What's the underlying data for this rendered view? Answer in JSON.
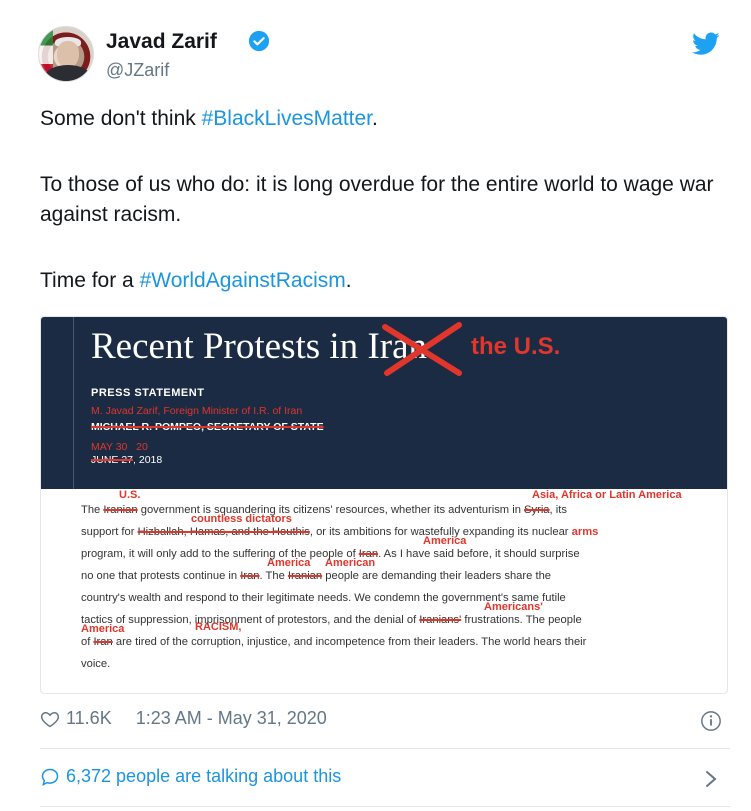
{
  "author": {
    "name": "Javad Zarif",
    "handle": "@JZarif"
  },
  "tweet": {
    "line1_text": "Some don't think ",
    "line1_hashtag": "#BlackLivesMatter",
    "line1_end": ".",
    "line2": "To those of us who do: it is long overdue for the entire world to wage war against racism.",
    "line3_text": "Time for a ",
    "line3_hashtag": "#WorldAgainstRacism",
    "line3_end": "."
  },
  "media": {
    "title": "Recent Protests in ",
    "title_struck": "Iran",
    "title_replacement": "the U.S.",
    "press_statement": "PRESS STATEMENT",
    "author_new": "M. Javad Zarif, Foreign Minister of I.R. of Iran",
    "author_old": "MICHAEL R. POMPEO, SECRETARY OF STATE",
    "date_new_month": "MAY 30",
    "date_new_year": "20",
    "date_old": "JUNE 27",
    "date_old_year": ", 2018",
    "annotations": {
      "us": "U.S.",
      "asia": "Asia, Africa or Latin America",
      "dictators": "countless dictators",
      "arms": "arms",
      "america1": "America",
      "america2": "America",
      "american": "American",
      "americans": "Americans'",
      "america3": "America",
      "racism": "RACISM,"
    },
    "body": {
      "p1a": "The ",
      "p1_struck": "Iranian",
      "p1b": " government is squandering its citizens' resources, whether its adventurism in ",
      "p1_struck2": "Syria",
      "p1c": ", its",
      "p2a": "support for ",
      "p2_struck": "Hizballah, Hamas, and the Houthis",
      "p2b": ", or its ambitions for wastefully expanding its nuclear ",
      "p3a": "program, it will only add to the suffering of the people of ",
      "p3_struck": "Iran",
      "p3b": ". As I have said before, it should surprise",
      "p4a": "no one that protests continue in ",
      "p4_struck": "Iran",
      "p4b": ". The ",
      "p4_struck2": "Iranian",
      "p4c": " people are demanding their leaders share the",
      "p5": "country's wealth and respond to their legitimate needs. We condemn the government's same futile",
      "p6a": "tactics of suppression, imprisonment of protestors, and the denial of ",
      "p6_struck": "Iranians'",
      "p6b": " frustrations. The people",
      "p7a": "of ",
      "p7_struck": "Iran",
      "p7b": " are tired of the corruption, injustice, and incompetence from their leaders. The world hears their",
      "p8": "voice."
    }
  },
  "stats": {
    "likes": "11.6K",
    "timestamp": "1:23 AM - May 31, 2020",
    "talking": "6,372 people are talking about this"
  },
  "colors": {
    "link": "#1b95e0",
    "banner": "#1b2b43",
    "annotation": "#e0362c"
  }
}
